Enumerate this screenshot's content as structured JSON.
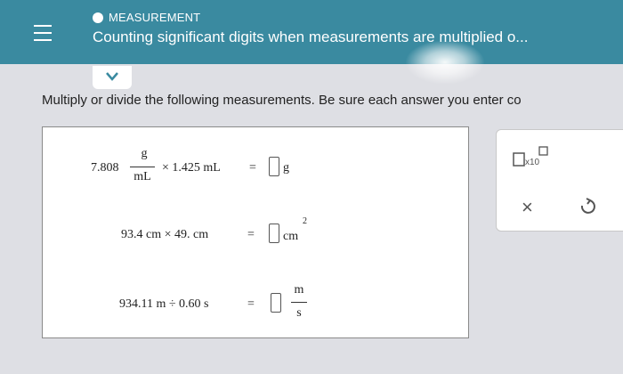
{
  "header": {
    "topic": "MEASUREMENT",
    "title": "Counting significant digits when measurements are multiplied o..."
  },
  "instruction": "Multiply or divide the following measurements. Be sure each answer you enter co",
  "equations": {
    "eq1": {
      "coefficient": "7.808",
      "frac_num": "g",
      "frac_den": "mL",
      "times": "× 1.425 mL",
      "equals": "=",
      "unit": "g"
    },
    "eq2": {
      "expr": "93.4 cm × 49. cm",
      "equals": "=",
      "unit": "cm",
      "exponent": "2"
    },
    "eq3": {
      "expr": "934.11 m ÷ 0.60 s",
      "equals": "=",
      "unit_num": "m",
      "unit_den": "s"
    }
  },
  "tools": {
    "sci_label": "x10",
    "clear": "×"
  },
  "colors": {
    "header": "#3a8aa0",
    "background": "#dedfe4"
  }
}
